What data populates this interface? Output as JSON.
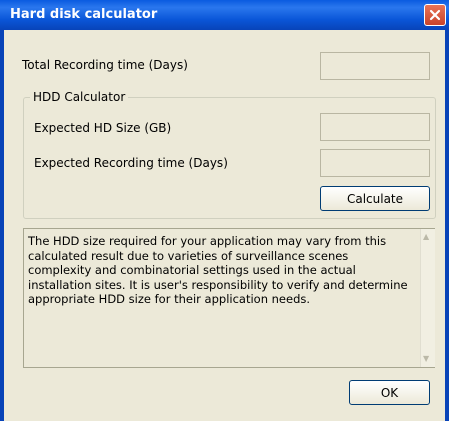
{
  "window": {
    "title": "Hard disk calculator"
  },
  "labels": {
    "total_recording_time": "Total Recording time (Days)",
    "hdd_calculator_group": "HDD Calculator",
    "expected_hd_size": "Expected HD Size (GB)",
    "expected_recording_time": "Expected Recording time (Days)"
  },
  "fields": {
    "total_recording_time": "",
    "expected_hd_size": "",
    "expected_recording_time": ""
  },
  "buttons": {
    "calculate": "Calculate",
    "ok": "OK"
  },
  "notice": {
    "text": "The HDD size required for your application may vary from this calculated result due to varieties of surveillance scenes complexity and combinatorial settings used in the actual installation sites. It is user's responsibility to verify and determine appropriate HDD size for their application needs."
  },
  "icons": {
    "close": "close-icon",
    "scroll_up": "scroll-up-arrow-icon",
    "scroll_down": "scroll-down-arrow-icon"
  },
  "colors": {
    "titlebar": "#0a56d8",
    "close_button": "#d9552f",
    "window_bg": "#ece9d8"
  }
}
